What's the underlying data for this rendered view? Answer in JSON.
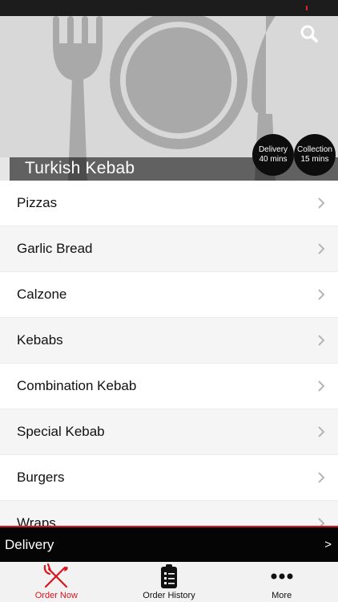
{
  "restaurant": {
    "name": "Turkish Kebab",
    "delivery_badge": {
      "label": "Delivery",
      "time": "40 mins"
    },
    "collection_badge": {
      "label": "Collection",
      "time": "15 mins"
    }
  },
  "icons": {
    "search": "search-icon",
    "chevron": "chevron-right-icon",
    "hero": "plate-cutlery-icon"
  },
  "menu": {
    "categories": [
      {
        "label": "Pizzas"
      },
      {
        "label": "Garlic Bread"
      },
      {
        "label": "Calzone"
      },
      {
        "label": "Kebabs"
      },
      {
        "label": "Combination Kebab"
      },
      {
        "label": "Special Kebab"
      },
      {
        "label": "Burgers"
      },
      {
        "label": "Wraps"
      }
    ]
  },
  "order_mode": {
    "label": "Delivery",
    "arrow": ">"
  },
  "tabs": [
    {
      "label": "Order Now",
      "icon": "fork-knife-icon",
      "active": true
    },
    {
      "label": "Order History",
      "icon": "clipboard-list-icon",
      "active": false
    },
    {
      "label": "More",
      "icon": "more-dots-icon",
      "active": false
    }
  ],
  "colors": {
    "accent": "#d9141c",
    "dark": "#050505",
    "hero_bg": "#d8d8d8"
  }
}
